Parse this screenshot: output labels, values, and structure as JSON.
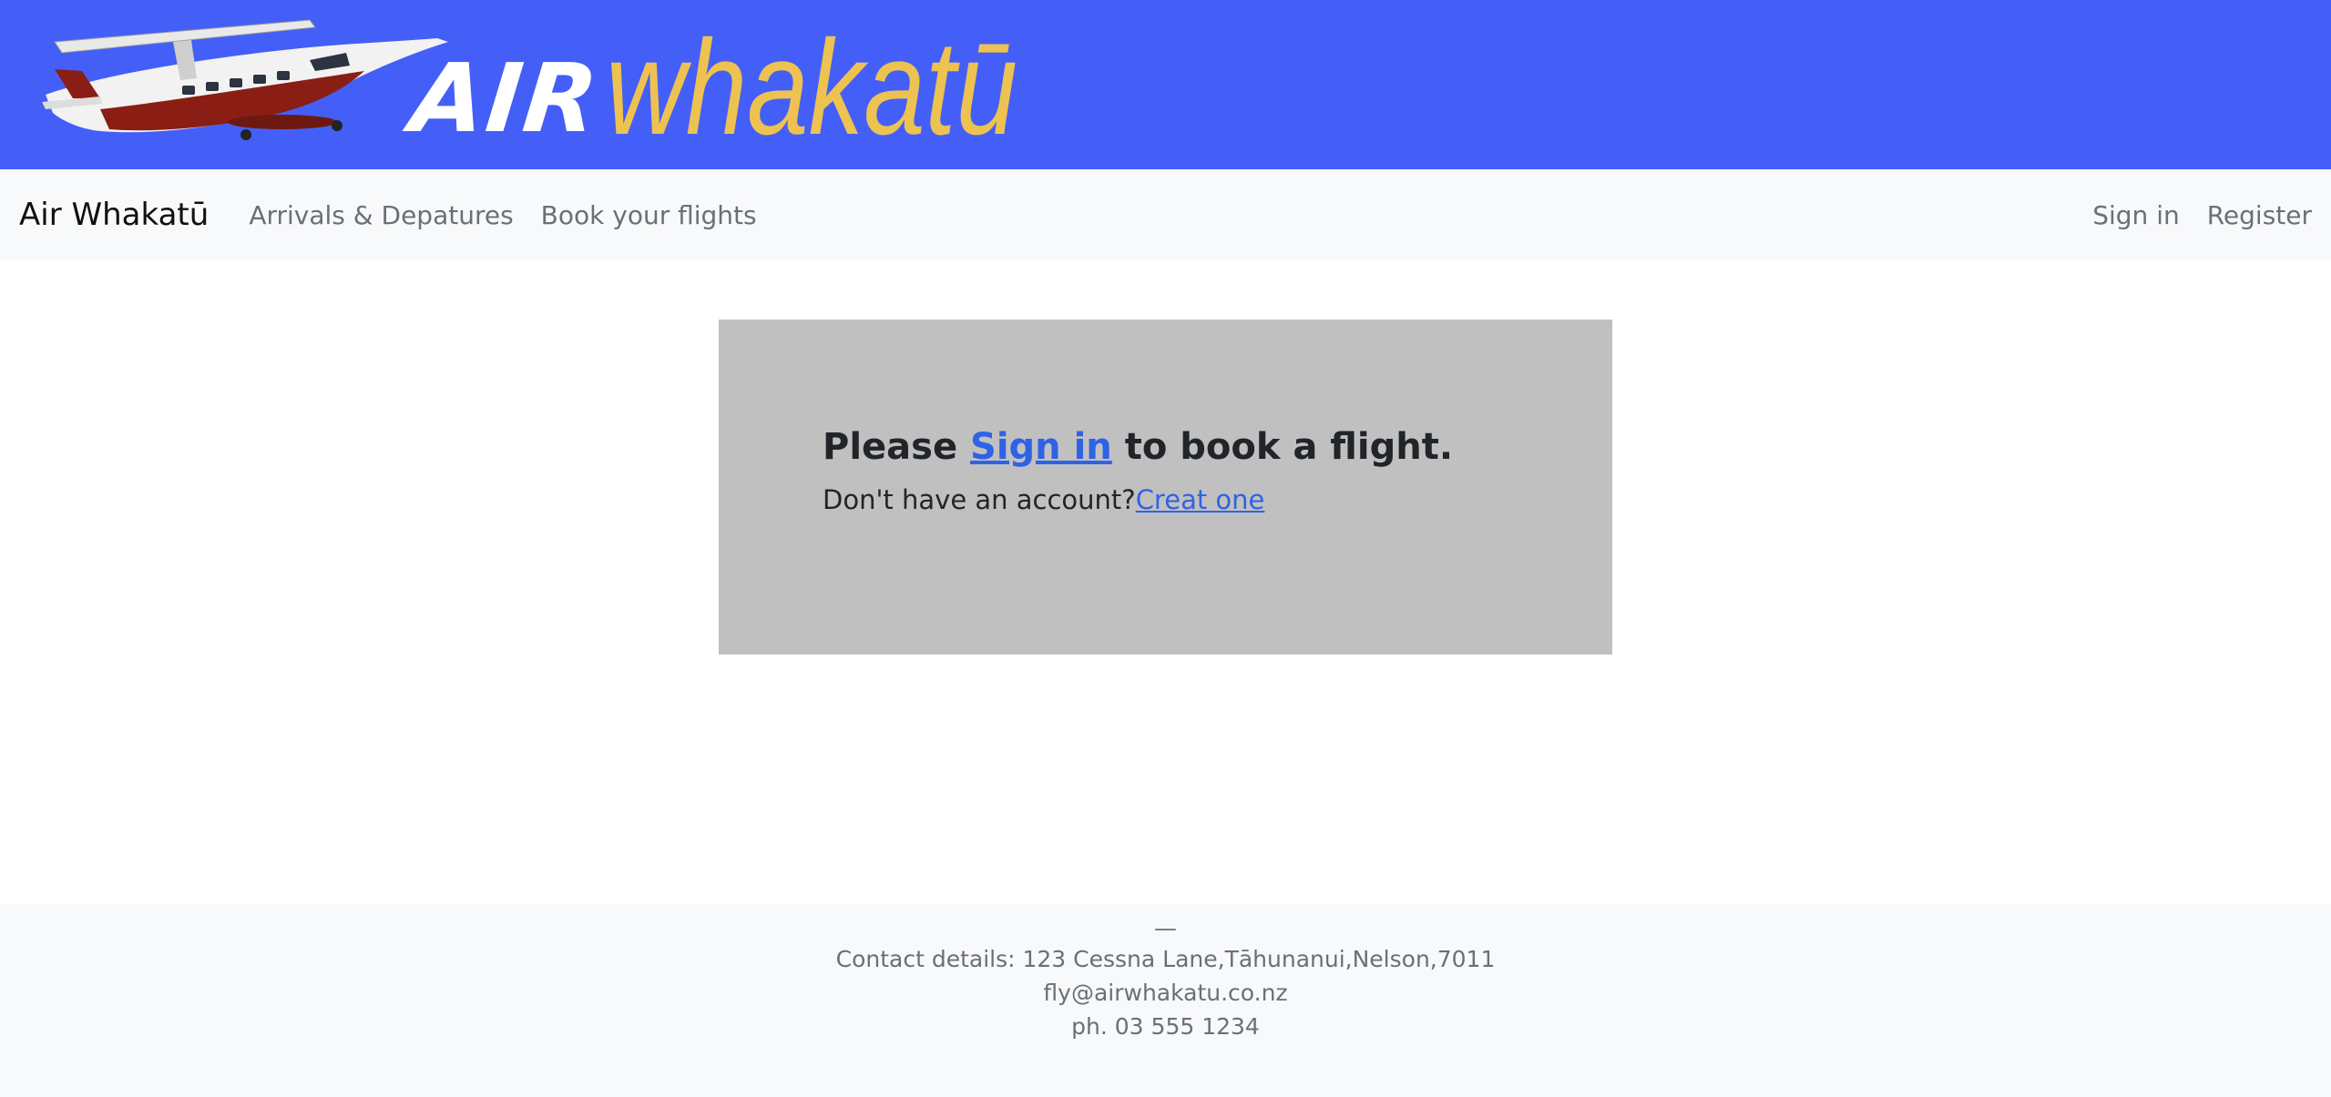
{
  "banner": {
    "logo_air": "AIR",
    "logo_whakatu": "whakatū",
    "plane_icon": "aircraft-image",
    "colors": {
      "background": "#445ff7",
      "air": "#ffffff",
      "whakatu": "#edc251"
    }
  },
  "navbar": {
    "brand": "Air Whakatū",
    "left_links": [
      "Arrivals & Depatures",
      "Book your flights"
    ],
    "right_links": [
      "Sign in",
      "Register"
    ]
  },
  "card": {
    "headline_before": "Please ",
    "headline_link": "Sign in",
    "headline_after": " to book a flight.",
    "sub_text": "Don't have an account?",
    "sub_link": "Creat one"
  },
  "footer": {
    "dash": "—",
    "address": "Contact details: 123 Cessna Lane,Tāhunanui,Nelson,7011",
    "email": "fly@airwhakatu.co.nz",
    "phone": "ph. 03 555 1234"
  }
}
